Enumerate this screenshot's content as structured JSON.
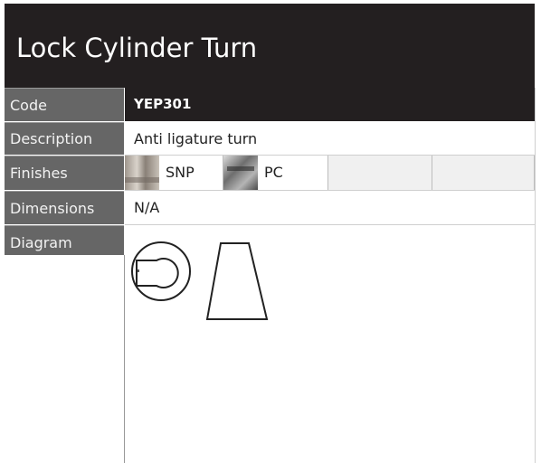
{
  "title": "Lock Cylinder Turn",
  "rows": {
    "code": {
      "label": "Code",
      "value": "YEP301"
    },
    "description": {
      "label": "Description",
      "value": "Anti ligature turn"
    },
    "finishes": {
      "label": "Finishes",
      "items": [
        {
          "name": "SNP",
          "swatch": "satin-nickel-swatch"
        },
        {
          "name": "PC",
          "swatch": "polished-chrome-swatch"
        }
      ]
    },
    "dimensions": {
      "label": "Dimensions",
      "value": "N/A"
    },
    "diagram": {
      "label": "Diagram"
    }
  },
  "colors": {
    "header_bg": "#231f20",
    "label_bg": "#666666"
  }
}
